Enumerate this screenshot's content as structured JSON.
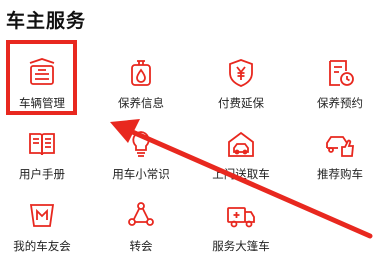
{
  "section": {
    "title": "车主服务"
  },
  "items": [
    {
      "label": "车辆管理",
      "icon": "car-garage-icon"
    },
    {
      "label": "保养信息",
      "icon": "oil-can-icon"
    },
    {
      "label": "付费延保",
      "icon": "yen-shield-icon"
    },
    {
      "label": "保养预约",
      "icon": "receipt-clock-icon"
    },
    {
      "label": "用户手册",
      "icon": "manual-book-icon"
    },
    {
      "label": "用车小常识",
      "icon": "lightbulb-icon"
    },
    {
      "label": "上门送取车",
      "icon": "door-car-icon"
    },
    {
      "label": "推荐购车",
      "icon": "car-thumbs-up-icon"
    },
    {
      "label": "我的车友会",
      "icon": "club-m-icon"
    },
    {
      "label": "转会",
      "icon": "share-nodes-icon"
    },
    {
      "label": "服务大篷车",
      "icon": "service-truck-icon"
    }
  ],
  "colors": {
    "accent": "#e8281f",
    "text": "#222222"
  }
}
